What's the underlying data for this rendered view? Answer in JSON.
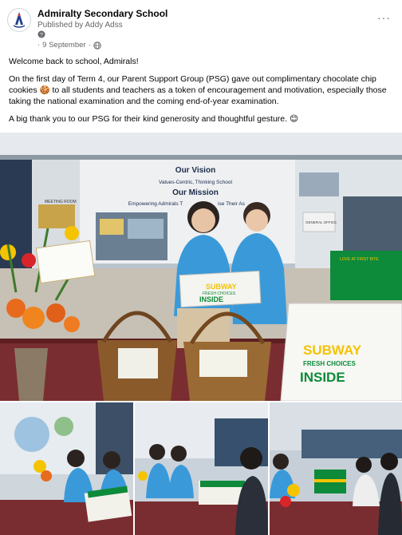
{
  "post": {
    "page_name": "Admiralty Secondary School",
    "published_by": "Published by Addy Adss",
    "question_icon": "?",
    "date": "9 September",
    "date_separator": "·",
    "audience_icon": "globe-icon",
    "more_icon": "···"
  },
  "content": {
    "paragraphs": [
      "Welcome back to school, Admirals!",
      "On the first day of Term 4, our Parent Support Group (PSG) gave out complimentary chocolate chip cookies 🍪 to all students and teachers as a token of encouragement and motivation, especially those taking the national examination and the coming end-of-year examination.",
      "A big thank you to our PSG for their kind generosity and thoughtful gesture. 😊"
    ]
  },
  "photo": {
    "banner_title": "Our Vision",
    "banner_line1": "Values-Centric, Thinking School",
    "banner_title2": "Our Mission",
    "banner_line2": "Empowering Admirals T",
    "banner_line2_end": "ise Their As",
    "sign_meeting": "MEETING ROOM",
    "sign_general": "GENERAL OFFICE",
    "box_brand": "SUBWAY",
    "box_tagline": "FRESH CHOICES",
    "box_inside": "INSIDE",
    "bag_brand": "SUBWAY",
    "bag_line1": "FRESH CHOICES",
    "bag_line2": "INSIDE",
    "crate_label": "LOVE AT FIRST BITE"
  },
  "colors": {
    "subway_green": "#0d8a3a",
    "subway_yellow": "#f4c300",
    "shirt_blue": "#3a9ad9",
    "link_gray": "#65676b"
  }
}
